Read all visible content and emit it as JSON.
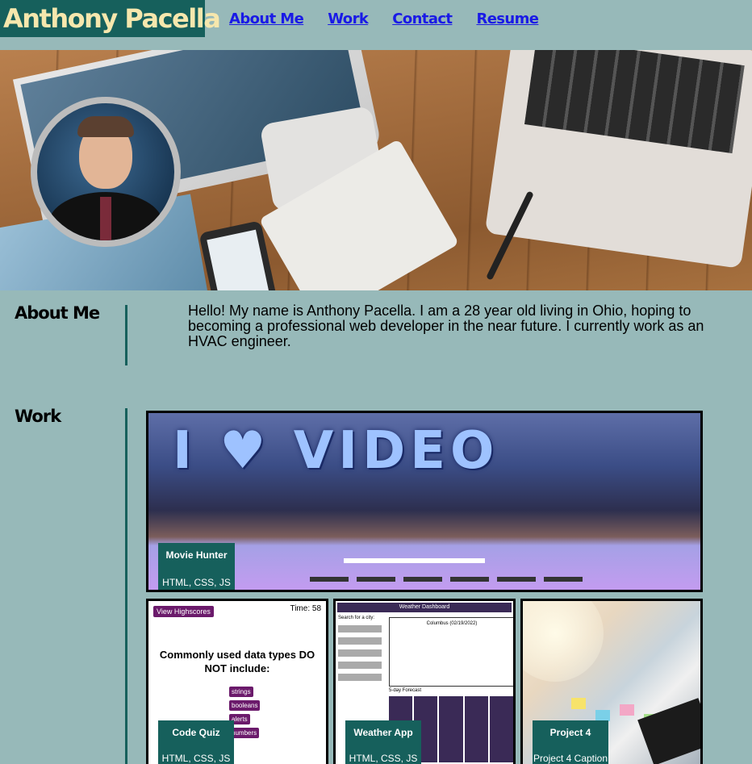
{
  "header": {
    "brand": "Anthony Pacella",
    "nav": [
      "About Me",
      "Work",
      "Contact",
      "Resume"
    ]
  },
  "about": {
    "title": "About Me",
    "text": "Hello! My name is Anthony Pacella. I am a 28 year old living in Ohio, hoping to becoming a professional web developer in the near future. I currently work as an HVAC engineer."
  },
  "work": {
    "title": "Work",
    "projects": [
      {
        "title": "Movie Hunter",
        "subtitle": "HTML, CSS, JS"
      },
      {
        "title": "Code Quiz",
        "subtitle": "HTML, CSS, JS"
      },
      {
        "title": "Weather App",
        "subtitle": "HTML, CSS, JS"
      },
      {
        "title": "Project 4",
        "subtitle": "Project 4 Caption"
      }
    ]
  },
  "thumbs": {
    "movie_sign": "I ♥ VIDEO",
    "quiz": {
      "highscores": "View Highscores",
      "timer": "Time: 58",
      "question": "Commonly used data types DO NOT include:",
      "options": [
        "strings",
        "booleans",
        "alerts",
        "numbers"
      ]
    },
    "weather": {
      "bar": "Weather Dashboard",
      "search_label": "Search for a city:",
      "city": "Columbus (02/19/2022)",
      "forecast": "5-day Forecast"
    }
  },
  "colors": {
    "background": "#97b9b9",
    "accent": "#16605c",
    "brand_text": "#f6e7ad",
    "link": "#1a1ae6"
  }
}
